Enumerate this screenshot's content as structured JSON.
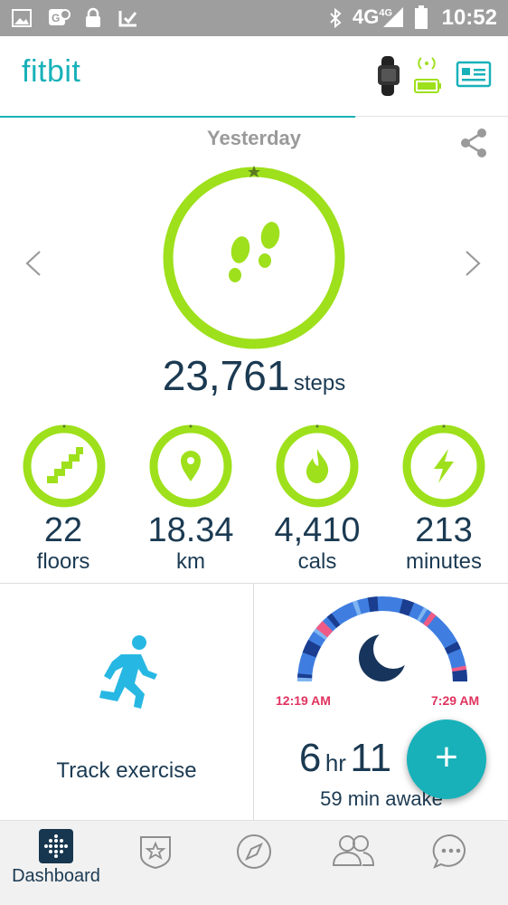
{
  "status_bar": {
    "network": "4G",
    "network_sup": "4G",
    "time": "10:52"
  },
  "header": {
    "logo": "fitbit"
  },
  "dashboard": {
    "day_label": "Yesterday",
    "steps": {
      "value": "23,761",
      "unit": "steps"
    },
    "stats": [
      {
        "value": "22",
        "unit": "floors",
        "icon": "stairs-icon"
      },
      {
        "value": "18.34",
        "unit": "km",
        "icon": "location-pin-icon"
      },
      {
        "value": "4,410",
        "unit": "cals",
        "icon": "flame-icon"
      },
      {
        "value": "213",
        "unit": "minutes",
        "icon": "lightning-icon"
      }
    ]
  },
  "exercise_card": {
    "label": "Track exercise"
  },
  "sleep_card": {
    "start_time": "12:19 AM",
    "end_time": "7:29 AM",
    "hours": "6",
    "hours_unit": "hr",
    "minutes": "11",
    "awake": "59 min awake"
  },
  "fab": {
    "label": "+"
  },
  "bottom_nav": {
    "dashboard_label": "Dashboard"
  },
  "colors": {
    "accent": "#18b1b9",
    "goal_green": "#9ee01b",
    "exercise_blue": "#27b7e3",
    "sleep_time": "#e0335e",
    "text": "#1b3a52"
  }
}
